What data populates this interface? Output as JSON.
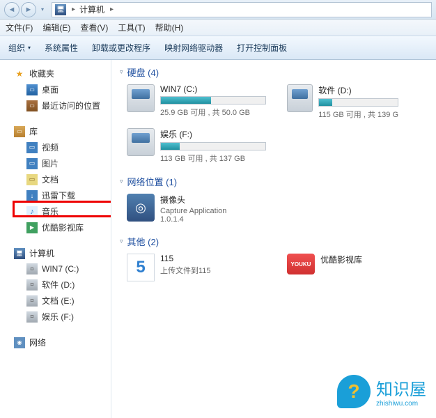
{
  "address": {
    "location": "计算机"
  },
  "menubar": {
    "file": "文件(F)",
    "edit": "编辑(E)",
    "view": "查看(V)",
    "tools": "工具(T)",
    "help": "帮助(H)"
  },
  "toolbar": {
    "organize": "组织",
    "sysprops": "系统属性",
    "uninstall": "卸载或更改程序",
    "mapnet": "映射网络驱动器",
    "cpanel": "打开控制面板"
  },
  "sidebar": {
    "favorites": "收藏夹",
    "desktop": "桌面",
    "recent": "最近访问的位置",
    "libraries": "库",
    "video": "视频",
    "pictures": "图片",
    "documents": "文档",
    "xunlei": "迅雷下载",
    "music": "音乐",
    "youku": "优酷影视库",
    "computer": "计算机",
    "win7c": "WIN7 (C:)",
    "software_d": "软件 (D:)",
    "documents_e": "文档 (E:)",
    "entertainment_f": "娱乐 (F:)",
    "network": "网络"
  },
  "sections": {
    "drives": {
      "title": "硬盘 (4)"
    },
    "netloc": {
      "title": "网络位置 (1)"
    },
    "other": {
      "title": "其他 (2)"
    }
  },
  "drives": [
    {
      "name": "WIN7 (C:)",
      "free": "25.9 GB 可用 , 共 50.0 GB",
      "pct": 48
    },
    {
      "name": "软件 (D:)",
      "free": "115 GB 可用 , 共 139 G",
      "pct": 17
    },
    {
      "name": "娱乐 (F:)",
      "free": "113 GB 可用 , 共 137 GB",
      "pct": 18
    }
  ],
  "netloc": {
    "name": "摄像头",
    "app": "Capture Application",
    "ver": "1.0.1.4"
  },
  "other": {
    "a": {
      "name": "115",
      "sub": "上传文件到115"
    },
    "b": {
      "name": "优酷影视库"
    }
  },
  "watermark": {
    "title": "知识屋",
    "sub": "zhishiwu.com"
  }
}
